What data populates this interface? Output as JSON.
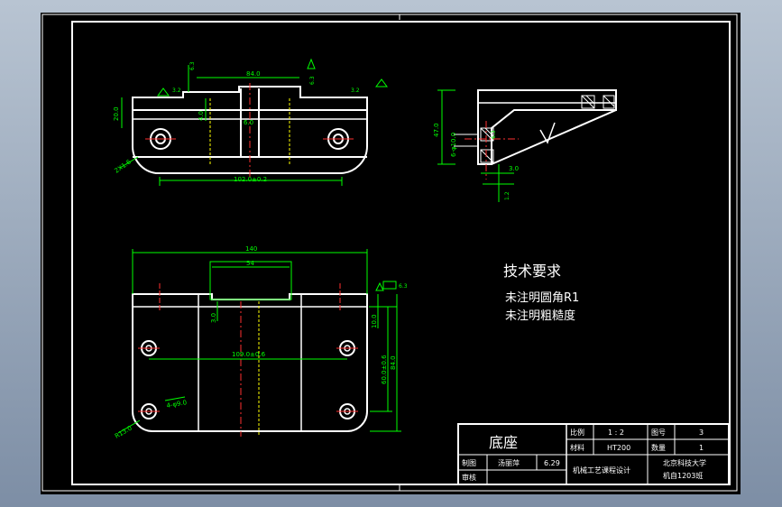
{
  "tech_requirements": {
    "heading": "技术要求",
    "line1": "未注明圆角R1",
    "line2": "未注明粗糙度"
  },
  "top_view": {
    "dim_top": "84.0",
    "dim_bottom": "102.0±0.2",
    "dim_left_h": "20.0",
    "dim_mid": "4.0",
    "dim_slot": "6.0",
    "dim_radius": "2X1.6",
    "rough_left": "6.3",
    "rough_right": "6.3",
    "rough_small_left": "3.2",
    "rough_small_right": "3.2"
  },
  "side_view": {
    "dim_height": "47.0",
    "dim_bore": "6-φ10.0",
    "dim_step": "3.0",
    "dim_small": "1.2",
    "rough_center": "6.3"
  },
  "front_view": {
    "dim_width": "140",
    "dim_slot_width": "54",
    "dim_hole_spacing": "109.0±0.6",
    "dim_slot_depth": "3.0",
    "dim_right_top": "10.0",
    "dim_right_mid": "60.0±0.6",
    "dim_right_total": "84.0",
    "dim_holes": "4-φ9.0",
    "dim_radius": "R13.0",
    "rough": "6.3"
  },
  "title_block": {
    "part_name": "底座",
    "scale_label": "比例",
    "scale_value": "1 : 2",
    "drawing_no_label": "图号",
    "drawing_no_value": "3",
    "material_label": "材料",
    "material_value": "HT200",
    "qty_label": "数量",
    "qty_value": "1",
    "drawn_label": "制图",
    "drawn_by": "汤丽萍",
    "date": "6.29",
    "checked_label": "审核",
    "course": "机械工艺课程设计",
    "school": "北京科技大学",
    "class": "机自1203班"
  }
}
